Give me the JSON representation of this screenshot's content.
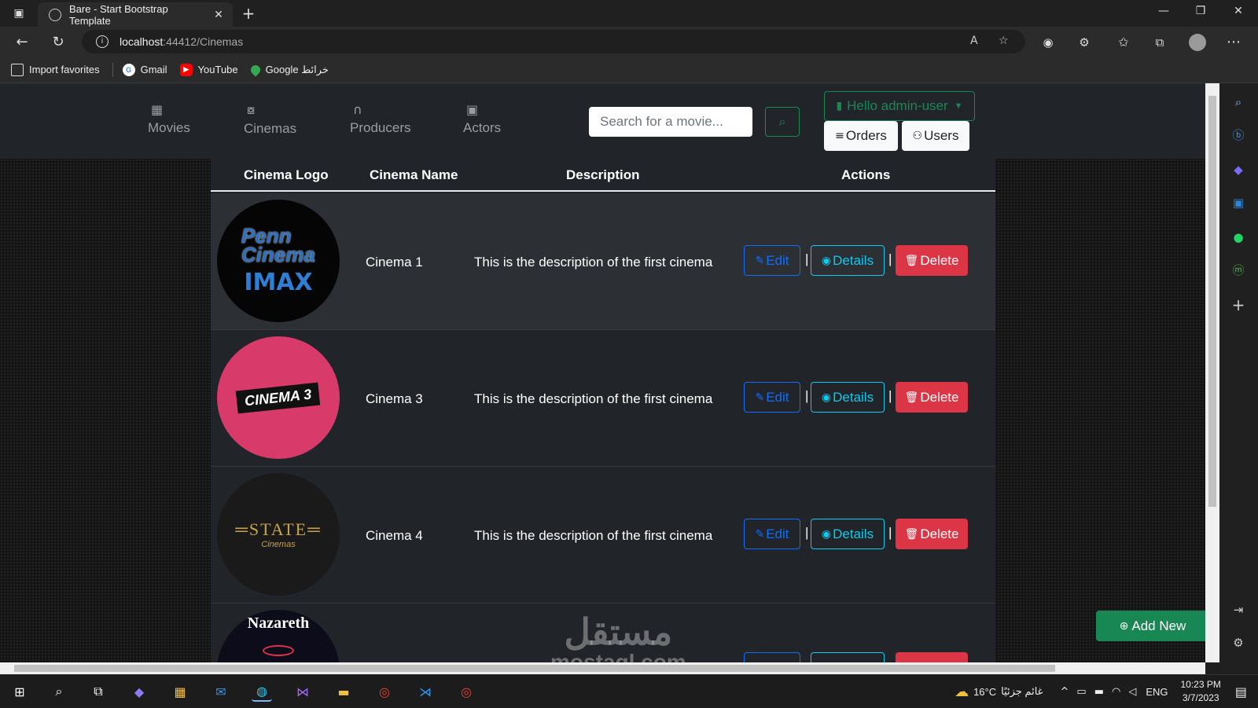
{
  "browser": {
    "tab_title": "Bare - Start Bootstrap Template",
    "url_host": "localhost",
    "url_path": ":44412/Cinemas",
    "favorites": [
      {
        "label": "Import favorites",
        "icon": "import-icon"
      },
      {
        "label": "Gmail",
        "icon": "google-icon"
      },
      {
        "label": "YouTube",
        "icon": "youtube-icon"
      },
      {
        "label": "Google خرائط",
        "icon": "maps-icon"
      }
    ]
  },
  "nav": {
    "items": [
      {
        "label": "Movies",
        "icon": "film-icon"
      },
      {
        "label": "Cinemas",
        "icon": "camera-reels-icon"
      },
      {
        "label": "Producers",
        "icon": "headset-icon"
      },
      {
        "label": "Actors",
        "icon": "person-square-icon"
      }
    ],
    "search_placeholder": "Search for a movie...",
    "hello_label": "Hello admin-user",
    "orders_label": "Orders",
    "users_label": "Users"
  },
  "table": {
    "headers": [
      "Cinema Logo",
      "Cinema Name",
      "Description",
      "Actions"
    ],
    "rows": [
      {
        "name": "Cinema 1",
        "description": "This is the description of the first cinema",
        "logo": "Penn Cinema IMAX"
      },
      {
        "name": "Cinema 3",
        "description": "This is the description of the first cinema",
        "logo": "Great Lakes Cinema 3"
      },
      {
        "name": "Cinema 4",
        "description": "This is the description of the first cinema",
        "logo": "STATE Cinemas"
      },
      {
        "name": "",
        "description": "",
        "logo": "Nazareth"
      }
    ],
    "edit_label": "Edit",
    "details_label": "Details",
    "delete_label": "Delete"
  },
  "add_new_label": "Add New",
  "watermark": {
    "arabic": "مستقل",
    "latin": "mostaql.com"
  },
  "taskbar": {
    "weather": "16°C",
    "weather_text": "غائم جزئيًا",
    "lang": "ENG",
    "time": "10:23 PM",
    "date": "3/7/2023"
  },
  "colors": {
    "success": "#198754",
    "primary": "#0d6efd",
    "info": "#0dcaf0",
    "danger": "#dc3545",
    "dark": "#212529"
  }
}
